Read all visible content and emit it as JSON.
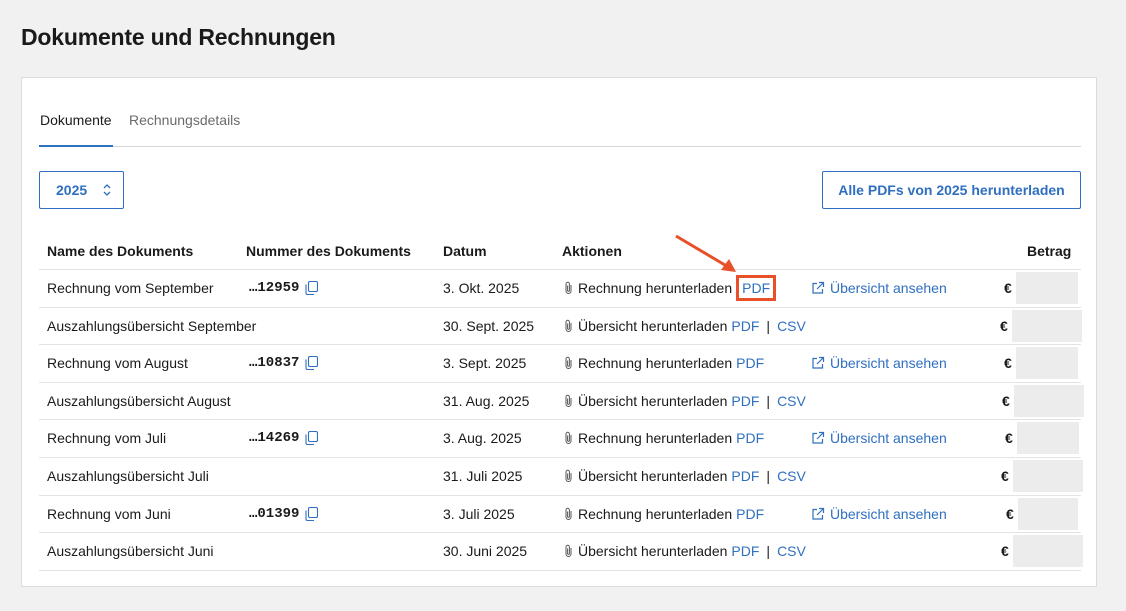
{
  "page": {
    "title": "Dokumente und Rechnungen"
  },
  "tabs": [
    {
      "label": "Dokumente",
      "active": true
    },
    {
      "label": "Rechnungsdetails",
      "active": false
    }
  ],
  "year_select": {
    "value": "2025"
  },
  "download_all": {
    "label": "Alle PDFs von 2025 herunterladen"
  },
  "table": {
    "headers": {
      "name": "Name des Dokuments",
      "number": "Nummer des Dokuments",
      "date": "Datum",
      "actions": "Aktionen",
      "amount": "Betrag"
    },
    "rows": [
      {
        "name": "Rechnung vom September",
        "number": "…12959",
        "date": "3. Okt. 2025",
        "action": "Rechnung herunterladen",
        "pdf": "PDF",
        "csv": "",
        "view": "Übersicht ansehen",
        "currency": "€"
      },
      {
        "name": "Auszahlungsübersicht September",
        "number": "",
        "date": "30. Sept. 2025",
        "action": "Übersicht herunterladen",
        "pdf": "PDF",
        "csv": "CSV",
        "view": "",
        "currency": "€"
      },
      {
        "name": "Rechnung vom August",
        "number": "…10837",
        "date": "3. Sept. 2025",
        "action": "Rechnung herunterladen",
        "pdf": "PDF",
        "csv": "",
        "view": "Übersicht ansehen",
        "currency": "€"
      },
      {
        "name": "Auszahlungsübersicht August",
        "number": "",
        "date": "31. Aug. 2025",
        "action": "Übersicht herunterladen",
        "pdf": "PDF",
        "csv": "CSV",
        "view": "",
        "currency": "€"
      },
      {
        "name": "Rechnung vom Juli",
        "number": "…14269",
        "date": "3. Aug. 2025",
        "action": "Rechnung herunterladen",
        "pdf": "PDF",
        "csv": "",
        "view": "Übersicht ansehen",
        "currency": "€"
      },
      {
        "name": "Auszahlungsübersicht Juli",
        "number": "",
        "date": "31. Juli 2025",
        "action": "Übersicht herunterladen",
        "pdf": "PDF",
        "csv": "CSV",
        "view": "",
        "currency": "€"
      },
      {
        "name": "Rechnung vom Juni",
        "number": "…01399",
        "date": "3. Juli 2025",
        "action": "Rechnung herunterladen",
        "pdf": "PDF",
        "csv": "",
        "view": "Übersicht ansehen",
        "currency": "€"
      },
      {
        "name": "Auszahlungsübersicht Juni",
        "number": "",
        "date": "30. Juni 2025",
        "action": "Übersicht herunterladen",
        "pdf": "PDF",
        "csv": "CSV",
        "view": "",
        "currency": "€"
      }
    ]
  },
  "colors": {
    "accent": "#2f6fc0",
    "highlight": "#e8502a"
  },
  "icons": {
    "copy": "copy-icon",
    "attachment": "paperclip-icon",
    "external": "external-link-icon",
    "select": "chevron-up-down-icon"
  }
}
